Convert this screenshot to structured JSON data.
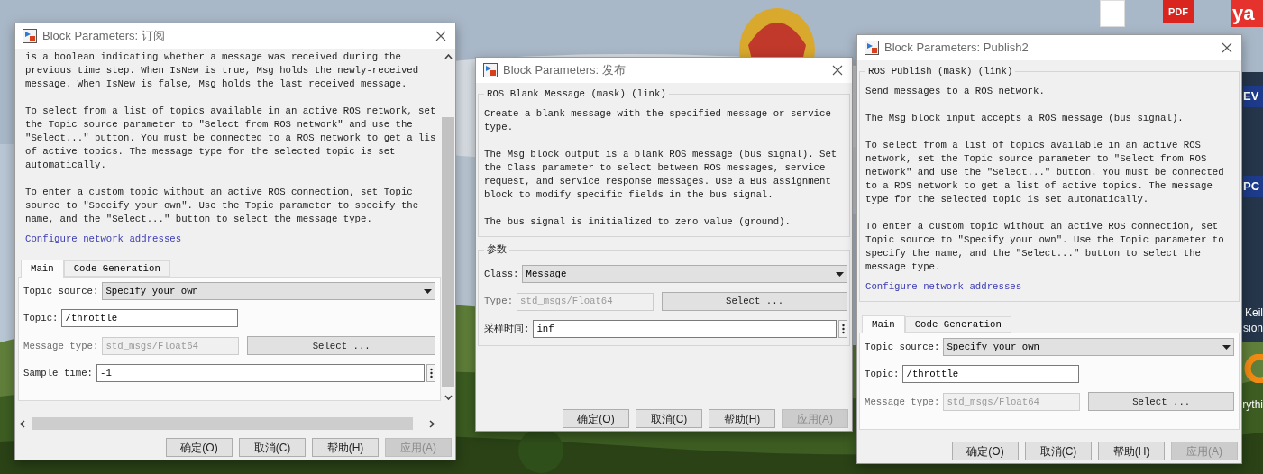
{
  "desktop_icons": [
    {
      "kind": "file"
    },
    {
      "kind": "pdf",
      "label": "PDF"
    },
    {
      "kind": "logo",
      "label": "ya"
    },
    {
      "kind": "tile",
      "label": "EV"
    },
    {
      "kind": "tile",
      "label": "PC"
    },
    {
      "kind": "label",
      "label": "Keil"
    },
    {
      "kind": "label",
      "label": "sion"
    },
    {
      "kind": "ring"
    },
    {
      "kind": "label",
      "label": "rythi"
    }
  ],
  "windows": [
    {
      "title": "Block Parameters: 订阅",
      "scrollable": true,
      "paragraphs": [
        "is a boolean indicating whether a message was received during the\nprevious time step. When IsNew is true, Msg holds the newly-received\nmessage. When IsNew is false, Msg holds the last received message.",
        "To select from a list of topics available in an active ROS network, set\nthe Topic source parameter to \"Select from ROS network\" and use the\n\"Select...\" button. You must be connected to a ROS network to get a lis\nof active topics. The message type for the selected topic is set\nautomatically.",
        "To enter a custom topic without an active ROS connection, set Topic\nsource to \"Specify your own\". Use the Topic parameter to specify the\nname, and the \"Select...\" button to select the message type."
      ],
      "link": "Configure network addresses",
      "tabs": [
        {
          "label": "Main",
          "selected": true
        },
        {
          "label": "Code Generation",
          "selected": false
        }
      ],
      "fields": [
        {
          "kind": "dropdown",
          "label": "Topic source:",
          "value": "Specify your own"
        },
        {
          "kind": "text",
          "label": "Topic:",
          "value": "/throttle"
        },
        {
          "kind": "type",
          "label": "Message type:",
          "value": "std_msgs/Float64",
          "button": "Select ..."
        },
        {
          "kind": "time",
          "label": "Sample time:",
          "value": "-1"
        }
      ],
      "buttons": [
        {
          "label": "确定(O)",
          "disabled": false
        },
        {
          "label": "取消(C)",
          "disabled": false
        },
        {
          "label": "帮助(H)",
          "disabled": false
        },
        {
          "label": "应用(A)",
          "disabled": true
        }
      ]
    },
    {
      "title": "Block Parameters: 发布",
      "scrollable": false,
      "group_title": "ROS Blank Message (mask) (link)",
      "paragraphs": [
        "Create a blank message with the specified message or service\ntype.",
        "The Msg block output is a blank ROS message (bus signal). Set\nthe Class parameter to select between ROS messages, service\nrequest, and service response messages. Use a Bus assignment\nblock to modify specific fields in the bus signal.",
        "The bus signal is initialized to zero value (ground)."
      ],
      "params_title": "参数",
      "fields": [
        {
          "kind": "dropdown",
          "label": "Class:",
          "value": "Message"
        },
        {
          "kind": "type",
          "label": "Type:",
          "value": "std_msgs/Float64",
          "button": "Select ..."
        },
        {
          "kind": "time",
          "label": "采样时间:",
          "value": "inf"
        }
      ],
      "buttons": [
        {
          "label": "确定(O)",
          "disabled": false
        },
        {
          "label": "取消(C)",
          "disabled": false
        },
        {
          "label": "帮助(H)",
          "disabled": false
        },
        {
          "label": "应用(A)",
          "disabled": true
        }
      ]
    },
    {
      "title": "Block Parameters: Publish2",
      "scrollable": false,
      "group_title": "ROS Publish (mask) (link)",
      "paragraphs": [
        "Send messages to a ROS network.",
        "The Msg block input accepts a ROS message (bus signal).",
        "To select from a list of topics available in an active ROS\nnetwork, set the Topic source parameter to \"Select from ROS\nnetwork\" and use the \"Select...\" button. You must be connected\nto a ROS network to get a list of active topics. The message\ntype for the selected topic is set automatically.",
        "To enter a custom topic without an active ROS connection, set\nTopic source to \"Specify your own\". Use the Topic parameter to\nspecify the name, and the \"Select...\" button to select the\nmessage type."
      ],
      "link": "Configure network addresses",
      "tabs": [
        {
          "label": "Main",
          "selected": true
        },
        {
          "label": "Code Generation",
          "selected": false
        }
      ],
      "fields": [
        {
          "kind": "dropdown",
          "label": "Topic source:",
          "value": "Specify your own"
        },
        {
          "kind": "text",
          "label": "Topic:",
          "value": "/throttle"
        },
        {
          "kind": "type",
          "label": "Message type:",
          "value": "std_msgs/Float64",
          "button": "Select ..."
        }
      ],
      "buttons": [
        {
          "label": "确定(O)",
          "disabled": false
        },
        {
          "label": "取消(C)",
          "disabled": false
        },
        {
          "label": "帮助(H)",
          "disabled": false
        },
        {
          "label": "应用(A)",
          "disabled": true
        }
      ]
    }
  ]
}
